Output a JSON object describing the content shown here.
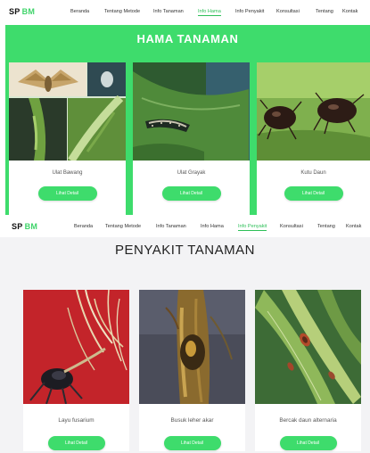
{
  "colors": {
    "accent": "#3edc6c",
    "accent_dark": "#2dbf58"
  },
  "top": {
    "brand": {
      "sp": "SP",
      "bm": "BM"
    },
    "nav": [
      "Beranda",
      "Tentang Metode",
      "Info Tanaman",
      "Info Hama",
      "Info Penyakit",
      "Konsultasi",
      "Tentang",
      "Kontak"
    ],
    "active": "Info Hama",
    "title": "HAMA TANAMAN",
    "cards": [
      {
        "name": "Ulat Bawang",
        "button": "Lihat Detail"
      },
      {
        "name": "Ulat Grayak",
        "button": "Lihat Detail"
      },
      {
        "name": "Kutu Daun",
        "button": "Lihat Detail"
      }
    ]
  },
  "bottom": {
    "brand": {
      "sp": "SP",
      "bm": "BM"
    },
    "nav": [
      "Beranda",
      "Tentang Metode",
      "Info Tanaman",
      "Info Hama",
      "Info Penyakit",
      "Konsultasi",
      "Tentang",
      "Kontak"
    ],
    "active": "Info Penyakit",
    "title": "PENYAKIT TANAMAN",
    "cards": [
      {
        "name": "Layu fusarium",
        "button": "Lihat Detail"
      },
      {
        "name": "Busuk leher akar",
        "button": "Lihat Detail"
      },
      {
        "name": "Bercak daun alternaria",
        "button": "Lihat Detail"
      }
    ]
  }
}
